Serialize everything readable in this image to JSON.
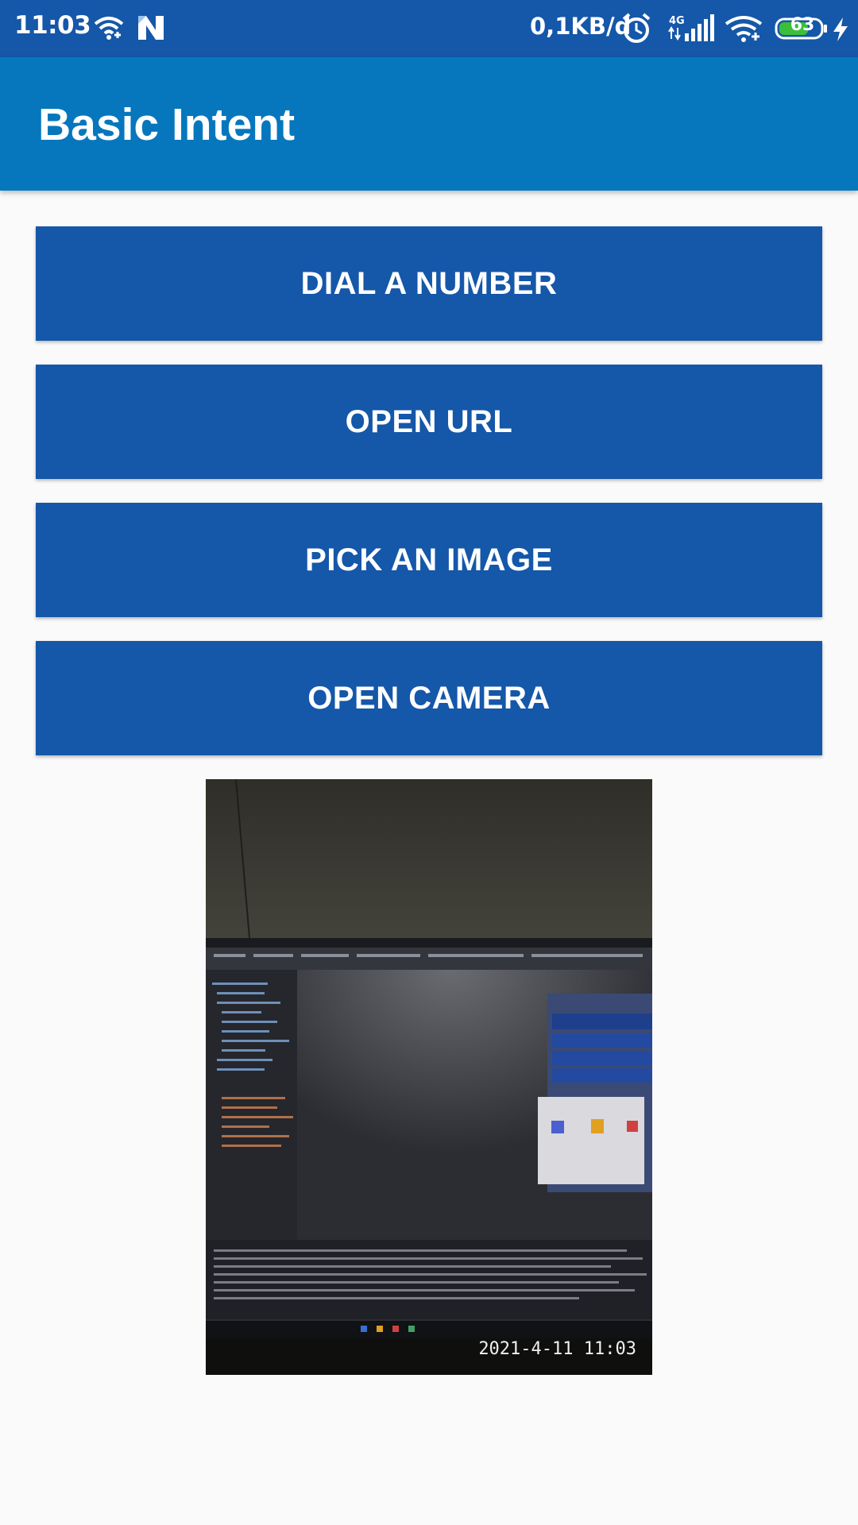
{
  "status_bar": {
    "time": "11:03",
    "network_speed": "0,1KB/d",
    "network_type": "4G",
    "battery_level": "63",
    "icons": [
      "wifi-icon",
      "n-app-icon",
      "alarm-icon",
      "signal-icon",
      "wifi-icon",
      "battery-icon",
      "charging-icon"
    ]
  },
  "app_bar": {
    "title": "Basic Intent",
    "color": "#0677bd"
  },
  "buttons": {
    "dial": "DIAL A NUMBER",
    "open_url": "OPEN URL",
    "pick_image": "PICK AN IMAGE",
    "open_camera": "OPEN CAMERA",
    "color": "#1557a9"
  },
  "photo": {
    "timestamp": "2021-4-11 11:03"
  }
}
